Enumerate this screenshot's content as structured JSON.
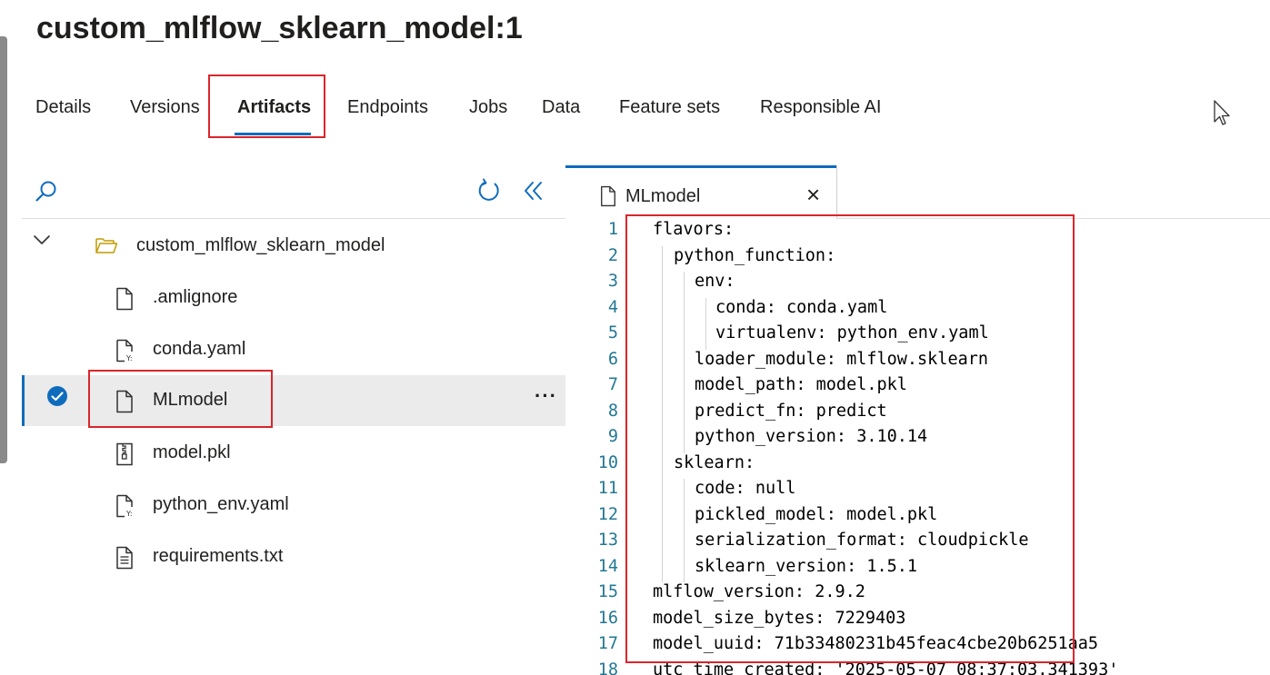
{
  "page": {
    "title": "custom_mlflow_sklearn_model:1"
  },
  "tabs": [
    {
      "label": "Details",
      "active": false
    },
    {
      "label": "Versions",
      "active": false
    },
    {
      "label": "Artifacts",
      "active": true
    },
    {
      "label": "Endpoints",
      "active": false
    },
    {
      "label": "Jobs",
      "active": false
    },
    {
      "label": "Data",
      "active": false
    },
    {
      "label": "Feature sets",
      "active": false
    },
    {
      "label": "Responsible AI",
      "active": false
    }
  ],
  "tree": {
    "toolbar": {
      "search_icon": "search-icon",
      "refresh_icon": "refresh-icon",
      "collapse_icon": "double-chevron-left-icon"
    },
    "root": {
      "label": "custom_mlflow_sklearn_model",
      "icon": "folder-open-icon",
      "expanded": true
    },
    "files": [
      {
        "label": ".amlignore",
        "icon": "file-icon"
      },
      {
        "label": "conda.yaml",
        "icon": "yaml-file-icon"
      },
      {
        "label": "MLmodel",
        "icon": "file-icon",
        "selected": true,
        "more_label": "···"
      },
      {
        "label": "model.pkl",
        "icon": "zip-file-icon"
      },
      {
        "label": "python_env.yaml",
        "icon": "yaml-file-icon"
      },
      {
        "label": "requirements.txt",
        "icon": "text-file-icon"
      }
    ]
  },
  "editor": {
    "tab_label": "MLmodel",
    "close_label": "×",
    "lines": [
      {
        "n": "1",
        "text": "flavors:",
        "indent": 0
      },
      {
        "n": "2",
        "text": "python_function:",
        "indent": 1
      },
      {
        "n": "3",
        "text": "env:",
        "indent": 2
      },
      {
        "n": "4",
        "text": "conda: conda.yaml",
        "indent": 3
      },
      {
        "n": "5",
        "text": "virtualenv: python_env.yaml",
        "indent": 3
      },
      {
        "n": "6",
        "text": "loader_module: mlflow.sklearn",
        "indent": 2
      },
      {
        "n": "7",
        "text": "model_path: model.pkl",
        "indent": 2
      },
      {
        "n": "8",
        "text": "predict_fn: predict",
        "indent": 2
      },
      {
        "n": "9",
        "text": "python_version: 3.10.14",
        "indent": 2
      },
      {
        "n": "10",
        "text": "sklearn:",
        "indent": 1
      },
      {
        "n": "11",
        "text": "code: null",
        "indent": 2
      },
      {
        "n": "12",
        "text": "pickled_model: model.pkl",
        "indent": 2
      },
      {
        "n": "13",
        "text": "serialization_format: cloudpickle",
        "indent": 2
      },
      {
        "n": "14",
        "text": "sklearn_version: 1.5.1",
        "indent": 2
      },
      {
        "n": "15",
        "text": "mlflow_version: 2.9.2",
        "indent": 0
      },
      {
        "n": "16",
        "text": "model_size_bytes: 7229403",
        "indent": 0
      },
      {
        "n": "17",
        "text": "model_uuid: 71b33480231b45feac4cbe20b6251aa5",
        "indent": 0
      },
      {
        "n": "18",
        "text": "utc_time_created: '2025-05-07 08:37:03.341393'",
        "indent": 0
      }
    ]
  },
  "colors": {
    "accent": "#0f6cbd",
    "highlight_box": "#d9262b",
    "line_number": "#237893"
  }
}
